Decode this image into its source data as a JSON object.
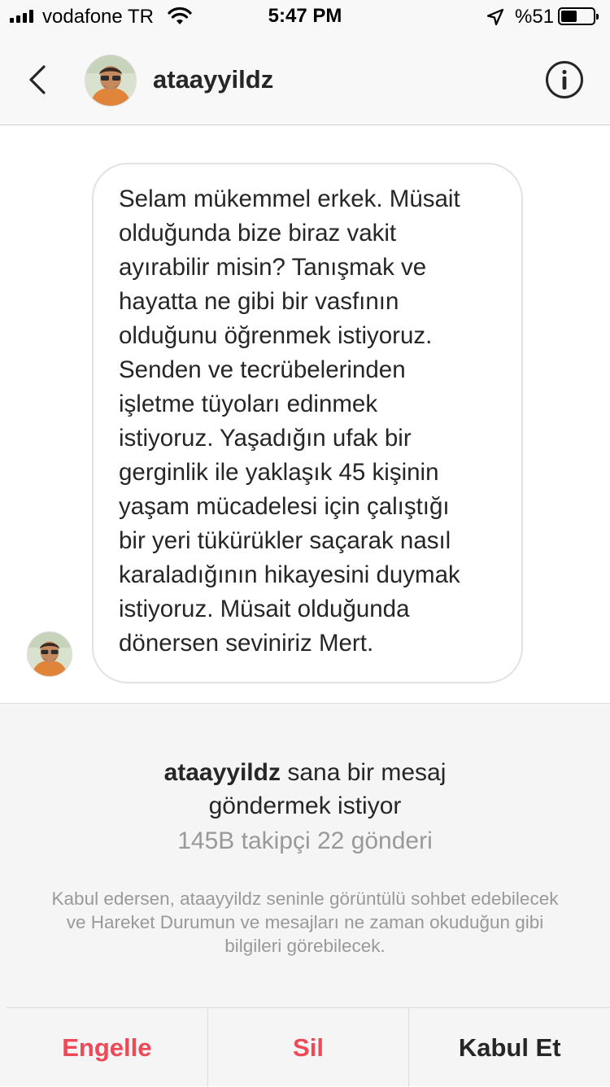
{
  "status_bar": {
    "carrier": "vodafone TR",
    "time": "5:47 PM",
    "battery_percent": "%51",
    "battery_level": 0.51,
    "icons": [
      "signal-icon",
      "wifi-icon",
      "location-arrow-icon",
      "battery-icon"
    ]
  },
  "header": {
    "username": "ataayyildz",
    "icons": [
      "back-chevron-icon",
      "info-icon"
    ]
  },
  "message": {
    "text": "Selam mükemmel erkek. Müsait\nolduğunda bize biraz vakit\nayırabilir misin? Tanışmak ve\nhayatta ne gibi bir vasfının\nolduğunu öğrenmek istiyoruz.\nSenden ve tecrübelerinden\nişletme tüyoları edinmek\nistiyoruz. Yaşadığın ufak bir\ngerginlik ile yaklaşık 45 kişinin\nyaşam mücadelesi için çalıştığı\nbir yeri tükürükler saçarak nasıl\nkaraladığının hikayesini duymak\nistiyoruz. Müsait olduğunda\ndönersen seviniriz Mert."
  },
  "request": {
    "username": "ataayyildz",
    "title_rest": " sana bir mesaj",
    "title_line2": "göndermek istiyor",
    "stats": "145B takipçi 22 gönderi",
    "notice": "Kabul edersen, ataayyildz seninle görüntülü sohbet edebilecek ve Hareket Durumun ve mesajları ne zaman okuduğun gibi bilgileri görebilecek."
  },
  "actions": {
    "block": "Engelle",
    "delete": "Sil",
    "accept": "Kabul Et"
  },
  "colors": {
    "danger": "#ed4956",
    "text": "#262626",
    "muted": "#999999",
    "panel_bg": "#f5f5f5"
  }
}
